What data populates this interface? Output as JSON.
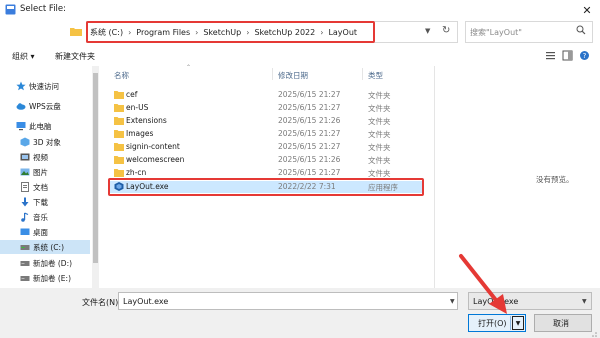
{
  "window": {
    "title": "Select File:",
    "close_glyph": "✕"
  },
  "address": {
    "crumbs": [
      "系统 (C:)",
      "Program Files",
      "SketchUp",
      "SketchUp 2022",
      "LayOut"
    ],
    "separator": "›"
  },
  "search": {
    "placeholder": "搜索\"LayOut\""
  },
  "toolbar": {
    "organize_label": "组织 ▾",
    "new_folder_label": "新建文件夹"
  },
  "nav": {
    "items": [
      {
        "label": "快速访问",
        "icon": "star-icon"
      },
      {
        "label": "WPS云盘",
        "icon": "cloud-icon"
      },
      {
        "label": "此电脑",
        "icon": "computer-icon"
      },
      {
        "label": "3D 对象",
        "icon": "cube-icon"
      },
      {
        "label": "视频",
        "icon": "video-icon"
      },
      {
        "label": "图片",
        "icon": "picture-icon"
      },
      {
        "label": "文档",
        "icon": "document-icon"
      },
      {
        "label": "下载",
        "icon": "download-icon"
      },
      {
        "label": "音乐",
        "icon": "music-icon"
      },
      {
        "label": "桌面",
        "icon": "desktop-icon"
      },
      {
        "label": "系统 (C:)",
        "icon": "drive-icon"
      },
      {
        "label": "新加卷 (D:)",
        "icon": "drive-icon"
      },
      {
        "label": "新加卷 (E:)",
        "icon": "drive-icon"
      }
    ]
  },
  "columns": {
    "name": "名称",
    "date": "修改日期",
    "type": "类型"
  },
  "files": [
    {
      "name": "cef",
      "date": "2025/6/15 21:27",
      "type": "文件夹",
      "kind": "folder"
    },
    {
      "name": "en-US",
      "date": "2025/6/15 21:27",
      "type": "文件夹",
      "kind": "folder"
    },
    {
      "name": "Extensions",
      "date": "2025/6/15 21:26",
      "type": "文件夹",
      "kind": "folder"
    },
    {
      "name": "Images",
      "date": "2025/6/15 21:27",
      "type": "文件夹",
      "kind": "folder"
    },
    {
      "name": "signin-content",
      "date": "2025/6/15 21:27",
      "type": "文件夹",
      "kind": "folder"
    },
    {
      "name": "welcomescreen",
      "date": "2025/6/15 21:26",
      "type": "文件夹",
      "kind": "folder"
    },
    {
      "name": "zh-cn",
      "date": "2025/6/15 21:27",
      "type": "文件夹",
      "kind": "folder"
    },
    {
      "name": "LayOut.exe",
      "date": "2022/2/22 7:31",
      "type": "应用程序",
      "kind": "exe"
    }
  ],
  "preview": {
    "text": "没有预览。"
  },
  "bottom": {
    "filename_label": "文件名(N):",
    "filename_value": "LayOut.exe",
    "filter_value": "LayOut.exe",
    "open_label": "打开(O)",
    "cancel_label": "取消"
  },
  "colors": {
    "accent": "#0078d7",
    "highlight": "#e53935",
    "folder": "#f5c244",
    "selection": "#cce8ff"
  }
}
